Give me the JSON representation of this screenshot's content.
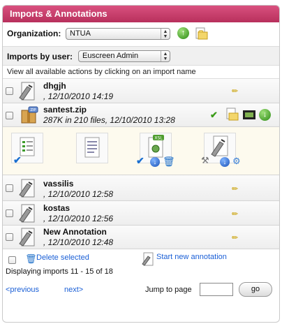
{
  "panel": {
    "title": "Imports & Annotations"
  },
  "organization": {
    "label": "Organization:",
    "selected": "NTUA"
  },
  "imports_by_user": {
    "label": "Imports by user:",
    "selected": "Euscreen Admin"
  },
  "hint": "View all available actions by clicking on an import name",
  "icon_labels": {
    "zip_badge": "ZIP",
    "xsl_badge": "XSL"
  },
  "imports": [
    {
      "name": "dhgjh",
      "meta": ", 12/10/2010 14:19"
    },
    {
      "name": "santest.zip",
      "meta": "287K in 210 files, 12/10/2010 13:28"
    },
    {
      "name": "vassilis",
      "meta": ", 12/10/2010 12:58"
    },
    {
      "name": "kostas",
      "meta": ", 12/10/2010 12:56"
    },
    {
      "name": "New Annotation",
      "meta": ", 12/10/2010 12:48"
    }
  ],
  "footer": {
    "delete_selected": "Delete selected",
    "start_new_annotation": "Start new annotation",
    "displaying": "Displaying imports 11 - 15 of 18",
    "previous": "<previous",
    "next": "next>",
    "jump_to_page": "Jump to page",
    "go": "go"
  },
  "colors": {
    "header_accent": "#c33a67",
    "link": "#1a5fd6",
    "actions_bg": "#fdfaee"
  }
}
